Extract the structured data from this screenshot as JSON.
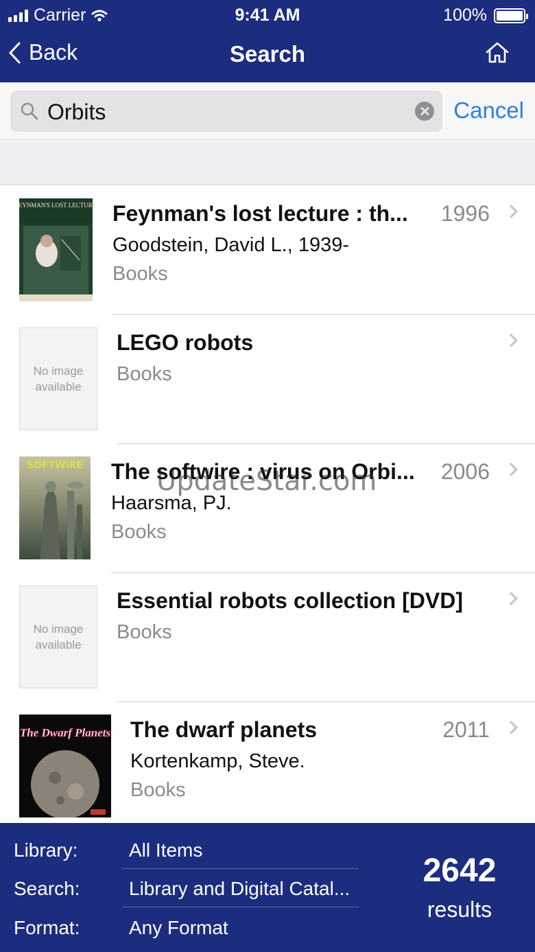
{
  "status_bar": {
    "carrier": "Carrier",
    "time": "9:41 AM",
    "battery": "100%"
  },
  "nav": {
    "back_label": "Back",
    "title": "Search",
    "home_icon": "home-icon"
  },
  "search": {
    "query": "Orbits",
    "cancel_label": "Cancel"
  },
  "results": [
    {
      "title": "Feynman's lost lecture : th...",
      "author": "Goodstein, David L., 1939-",
      "format": "Books",
      "year": "1996",
      "cover_text": "FEYNMAN'S LOST LECTURE"
    },
    {
      "title": "LEGO robots",
      "author": "",
      "format": "Books",
      "year": "",
      "no_image": "No image available"
    },
    {
      "title": "The softwire : virus on Orbi...",
      "author": "Haarsma, PJ.",
      "format": "Books",
      "year": "2006",
      "cover_text": "SOFTWIRE"
    },
    {
      "title": "Essential robots collection [DVD]",
      "author": "",
      "format": "Books",
      "year": "",
      "no_image": "No image available"
    },
    {
      "title": "The dwarf planets",
      "author": "Kortenkamp, Steve.",
      "format": "Books",
      "year": "2011",
      "cover_text": "The Dwarf Planets"
    }
  ],
  "watermark": "UpdateStar.com",
  "footer": {
    "library_label": "Library:",
    "library_value": "All Items",
    "search_label": "Search:",
    "search_value": "Library and Digital Catal...",
    "format_label": "Format:",
    "format_value": "Any Format",
    "results_count": "2642",
    "results_label": "results"
  },
  "colors": {
    "nav_bg": "#1c2d7f",
    "accent": "#2d7fe0"
  }
}
